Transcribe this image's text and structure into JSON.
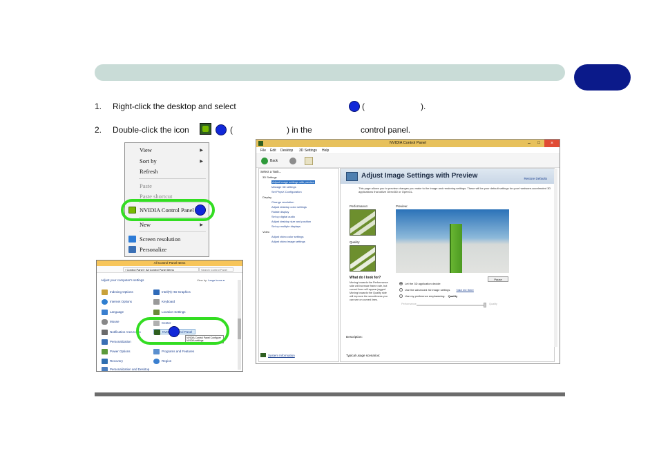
{
  "page": {
    "step1_num": "1.",
    "step1_text": "Right-click the desktop and select",
    "step1_paren_open": "(",
    "step1_paren_close": ").",
    "step2_num": "2.",
    "step2_text": "Double-click the icon",
    "step2_paren_open": "(",
    "step2_in_the": ") in the",
    "step2_panel": "control panel."
  },
  "context_menu": {
    "items": [
      "View",
      "Sort by",
      "Refresh",
      "Paste",
      "Paste shortcut",
      "NVIDIA Control Panel",
      "New",
      "Screen resolution",
      "Personalize"
    ]
  },
  "control_panel": {
    "title": "All Control Panel Items",
    "breadcrumb": "› Control Panel › All Control Panel Items",
    "search_placeholder": "Search Control Panel",
    "heading": "Adjust your computer's settings",
    "view_by": "View by:",
    "view_value": "Large icons ▾",
    "left_items": [
      "Indexing Options",
      "Internet Options",
      "Language",
      "Mouse",
      "Notification Area Icons",
      "Personalization",
      "Power Options",
      "Recovery",
      "Personalization and Desktop"
    ],
    "right_items": [
      "Intel(R) HD Graphics",
      "Keyboard",
      "Location Settings",
      "Center",
      "NVIDIA Control Panel",
      "",
      "Programs and Features",
      "Region"
    ],
    "tooltip": "NVIDIA Control Panel Configure NVIDIA settings"
  },
  "nvidia_panel": {
    "title": "NVIDIA Control Panel",
    "menu": [
      "File",
      "Edit",
      "Desktop",
      "3D Settings",
      "Help"
    ],
    "back": "Back",
    "select_task": "Select a Task...",
    "tree": [
      {
        "text": "3D Settings",
        "kind": "grp"
      },
      {
        "text": "Adjust image settings with preview",
        "kind": "sel"
      },
      {
        "text": "Manage 3D settings",
        "kind": "item"
      },
      {
        "text": "Set PhysX Configuration",
        "kind": "item"
      },
      {
        "text": "Display",
        "kind": "grp"
      },
      {
        "text": "Change resolution",
        "kind": "item"
      },
      {
        "text": "Adjust desktop color settings",
        "kind": "item"
      },
      {
        "text": "Rotate display",
        "kind": "item"
      },
      {
        "text": "Set up digital audio",
        "kind": "item"
      },
      {
        "text": "Adjust desktop size and position",
        "kind": "item"
      },
      {
        "text": "Set up multiple displays",
        "kind": "item"
      },
      {
        "text": "Video",
        "kind": "grp"
      },
      {
        "text": "Adjust video color settings",
        "kind": "item"
      },
      {
        "text": "Adjust video image settings",
        "kind": "item"
      }
    ],
    "system_info": "System Information",
    "heading": "Adjust Image Settings with Preview",
    "restore": "Restore Defaults",
    "description": "This page allows you to preview changes you make to the image and rendering settings. These will be your default settings for your hardware-accelerated 3D applications that utilize Direct3D or OpenGL.",
    "performance": "Performance:",
    "preview": "Preview:",
    "quality": "Quality:",
    "pause": "Pause",
    "look_for": "What do I look for?",
    "look_text": "Moving towards the Performance side will increase frame rate, but curved lines will appear jagged. Moving towards the Quality side will improve the smoothness you can see on curved lines.",
    "radios": [
      "Let the 3D application decide",
      "Use the advanced 3D image settings",
      "Use my preference emphasizing:"
    ],
    "take_me_there": "Take me there",
    "emphasis": "Quality",
    "slider_left": "Performance",
    "slider_right": "Quality",
    "desc_label": "Description:",
    "typical": "Typical usage scenarios:"
  },
  "colors": {
    "header_bar": "#c9dcd7",
    "chapter_tab": "#0b1a8a",
    "marker": "#1128d8",
    "highlight": "#33dd22"
  }
}
